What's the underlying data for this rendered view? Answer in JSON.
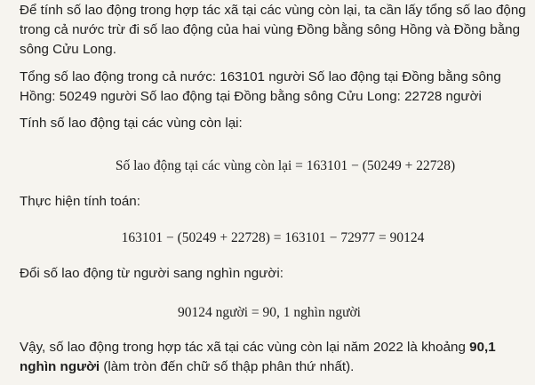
{
  "intro": "Để tính số lao động trong hợp tác xã tại các vùng còn lại, ta cần lấy tổng số lao động trong cả nước trừ đi số lao động của hai vùng Đồng bằng sông Hồng và Đồng bằng sông Cửu Long.",
  "totals_line": "Tổng số lao động trong cả nước: 163101 người Số lao động tại Đồng bằng sông Hồng: 50249 người Số lao động tại Đồng bằng sông Cửu Long: 22728 người",
  "step1_heading": "Tính số lao động tại các vùng còn lại:",
  "formula1": "Số lao động tại các vùng còn lại = 163101 − (50249 + 22728)",
  "step2_heading": "Thực hiện tính toán:",
  "formula2": "163101 − (50249 + 22728) = 163101 − 72977 = 90124",
  "step3_heading": "Đổi số lao động từ người sang nghìn người:",
  "formula3": "90124 người = 90, 1 nghìn người",
  "conclusion_pre": "Vậy, số lao động trong hợp tác xã tại các vùng còn lại năm 2022 là khoảng ",
  "conclusion_bold": "90,1 nghìn người",
  "conclusion_post": " (làm tròn đến chữ số thập phân thứ nhất)."
}
